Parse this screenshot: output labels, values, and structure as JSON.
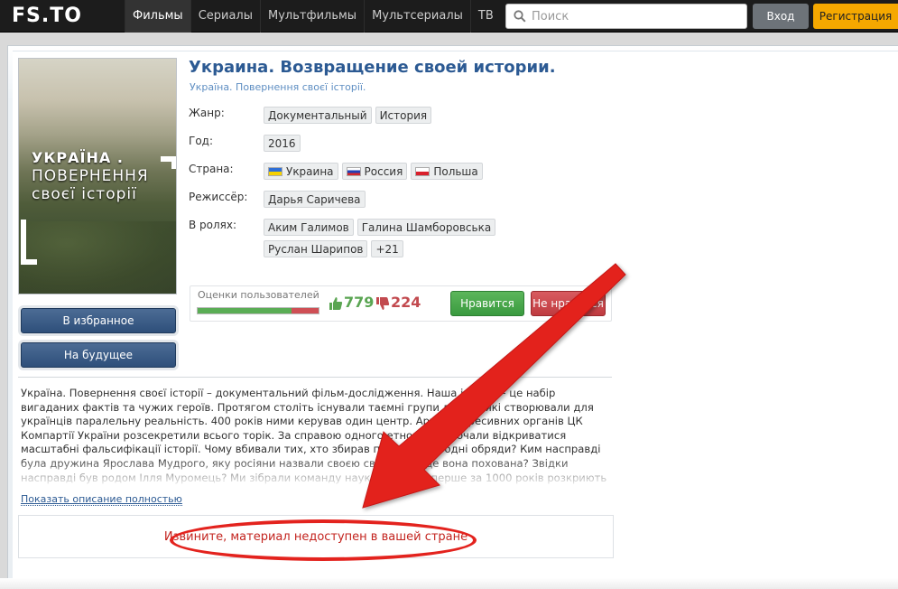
{
  "header": {
    "logo": "FS.TO",
    "nav": [
      "Фильмы",
      "Сериалы",
      "Мультфильмы",
      "Мультсериалы",
      "ТВ"
    ],
    "active_nav": "Фильмы",
    "search_placeholder": "Поиск",
    "login_label": "Вход",
    "register_label": "Регистрация"
  },
  "poster": {
    "line1": "УКРАЇНА .",
    "line2": "ПОВЕРНЕННЯ",
    "line3": "своєї історії"
  },
  "sidebar": {
    "favorites_label": "В избранное",
    "later_label": "На будущее"
  },
  "movie": {
    "title": "Украина. Возвращение своей истории.",
    "original_title": "Україна. Повернення своєї історії.",
    "genre_label": "Жанр:",
    "genres": [
      "Документальный",
      "История"
    ],
    "year_label": "Год:",
    "year": "2016",
    "country_label": "Страна:",
    "countries": [
      {
        "name": "Украина",
        "flag": "ua"
      },
      {
        "name": "Россия",
        "flag": "ru"
      },
      {
        "name": "Польша",
        "flag": "pl"
      }
    ],
    "director_label": "Режиссёр:",
    "director": "Дарья Саричева",
    "cast_label": "В ролях:",
    "cast": [
      "Аким Галимов",
      "Галина Шамборовська",
      "Руслан Шарипов",
      "+21"
    ]
  },
  "rating": {
    "label": "Оценки пользователей",
    "likes": "779",
    "dislikes": "224",
    "like_share": 0.777,
    "like_button": "Нравится",
    "dislike_button": "Не нравится"
  },
  "description": {
    "text": "Україна. Повернення своєї історії – документальний фільм-дослідження. Наша історія – це набір вигаданих фактів та чужих героїв. Протягом століть існували таємні групи людей, які створювали для українців паралельну реальність. 400 років ними керував один центр. Архів репресивних органів ЦК Компартії України розсекретили всього торік. За справою одного етнографа почали відкриватися масштабні фальсифікації історії. Чому вбивали тих, хто збирав по селах народні обряди? Ким насправді була дружина Ярослава Мудрого, яку росіяни назвали своєю святою, та де вона похована? Звідки насправді був родом Ілля Муромець? Ми зібрали команду науковців, які вперше за 1000 років розкриють історичну аферу.",
    "show_more": "Показать описание полностью"
  },
  "notice": {
    "text": "Извините, материал недоступен в вашей стране"
  },
  "colors": {
    "accent": "#2c5a93",
    "like": "#5aad55",
    "dislike": "#cf4f55",
    "annotation": "#e3231e"
  }
}
